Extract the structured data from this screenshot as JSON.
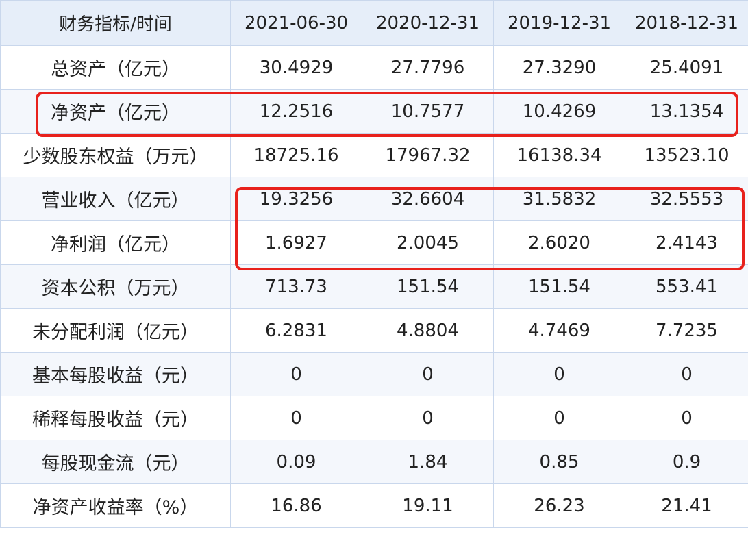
{
  "table": {
    "header": [
      "财务指标/时间",
      "2021-06-30",
      "2020-12-31",
      "2019-12-31",
      "2018-12-31"
    ],
    "rows": [
      [
        "总资产（亿元）",
        "30.4929",
        "27.7796",
        "27.3290",
        "25.4091"
      ],
      [
        "净资产（亿元）",
        "12.2516",
        "10.7577",
        "10.4269",
        "13.1354"
      ],
      [
        "少数股东权益（万元）",
        "18725.16",
        "17967.32",
        "16138.34",
        "13523.10"
      ],
      [
        "营业收入（亿元）",
        "19.3256",
        "32.6604",
        "31.5832",
        "32.5553"
      ],
      [
        "净利润（亿元）",
        "1.6927",
        "2.0045",
        "2.6020",
        "2.4143"
      ],
      [
        "资本公积（万元）",
        "713.73",
        "151.54",
        "151.54",
        "553.41"
      ],
      [
        "未分配利润（亿元）",
        "6.2831",
        "4.8804",
        "4.7469",
        "7.7235"
      ],
      [
        "基本每股收益（元）",
        "0",
        "0",
        "0",
        "0"
      ],
      [
        "稀释每股收益（元）",
        "0",
        "0",
        "0",
        "0"
      ],
      [
        "每股现金流（元）",
        "0.09",
        "1.84",
        "0.85",
        "0.9"
      ],
      [
        "净资产收益率（%）",
        "16.86",
        "19.11",
        "26.23",
        "21.41"
      ]
    ]
  },
  "colors": {
    "header_bg": "#e6eef9",
    "border": "#c9d7ec",
    "highlight": "#e8211c"
  }
}
